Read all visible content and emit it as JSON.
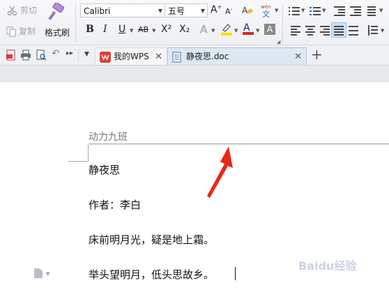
{
  "clipboard": {
    "cut_label": "剪切",
    "copy_label": "复制",
    "format_painter_label": "格式刷"
  },
  "font": {
    "family": "Calibri",
    "size": "五号"
  },
  "format_buttons": {
    "bold": "B",
    "italic": "I",
    "underline": "U",
    "strikethrough": "AB",
    "superscript": "X²",
    "subscript": "X₂"
  },
  "tabs": [
    {
      "label": "我的WPS"
    },
    {
      "label": "静夜思.doc"
    }
  ],
  "document": {
    "header_text": "动力九班",
    "lines": [
      "静夜思",
      "作者：李白",
      "床前明月光，疑是地上霜。",
      "举头望明月，低头思故乡。"
    ]
  },
  "watermark": "Baidu经验",
  "colors": {
    "accent_red": "#e23d2f",
    "font_color_bar": "#d9262c",
    "highlight_bar": "#f5e100"
  }
}
